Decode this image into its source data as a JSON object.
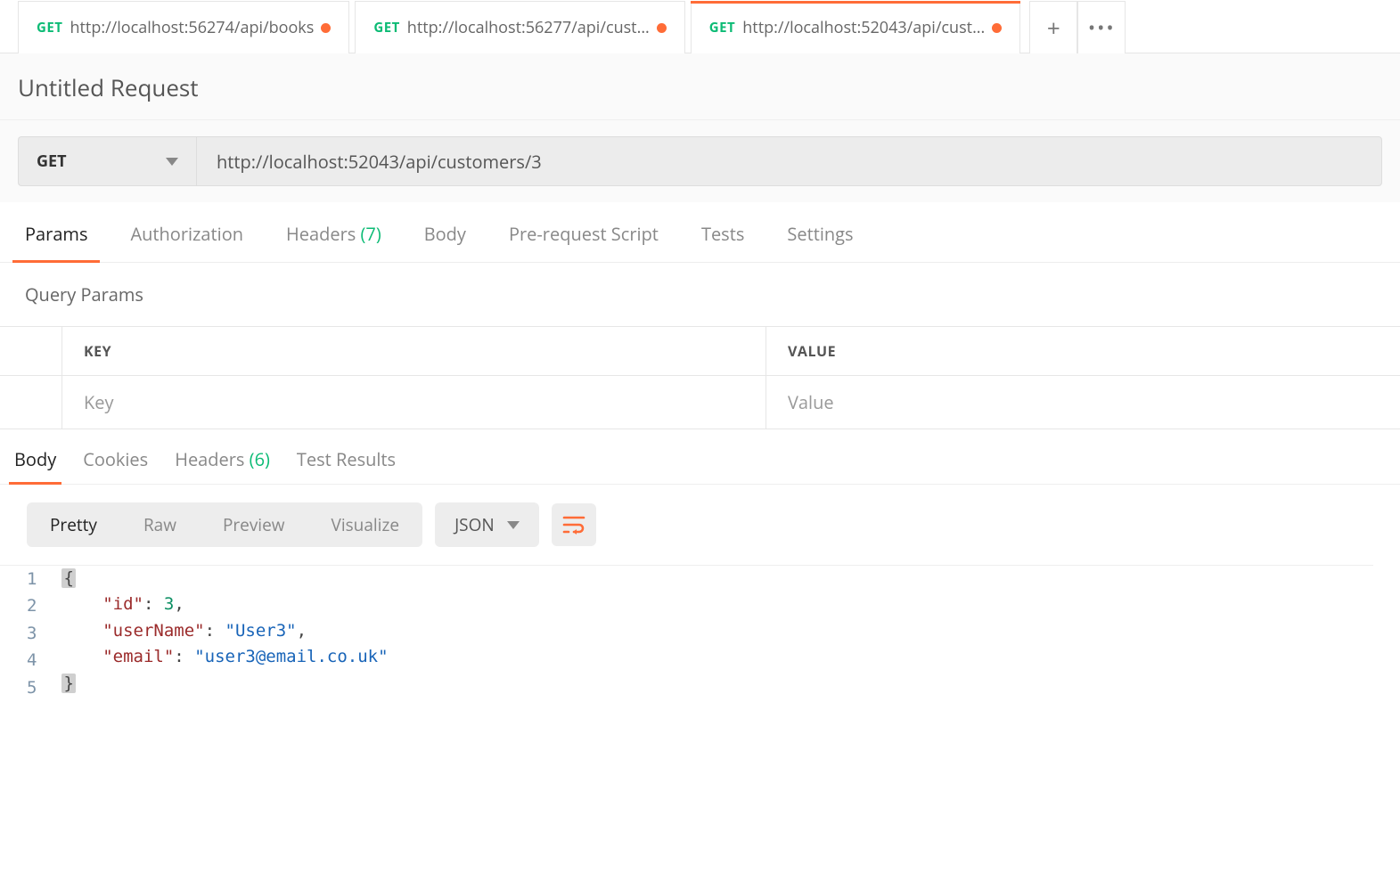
{
  "tabs": [
    {
      "method": "GET",
      "url": "http://localhost:56274/api/books",
      "dirty": true,
      "active": false
    },
    {
      "method": "GET",
      "url": "http://localhost:56277/api/cust...",
      "dirty": true,
      "active": false
    },
    {
      "method": "GET",
      "url": "http://localhost:52043/api/cust...",
      "dirty": true,
      "active": true
    }
  ],
  "request": {
    "title": "Untitled Request",
    "method": "GET",
    "url": "http://localhost:52043/api/customers/3"
  },
  "innerTabs": {
    "params": "Params",
    "authorization": "Authorization",
    "headers_label": "Headers",
    "headers_count": "(7)",
    "body": "Body",
    "prereq": "Pre-request Script",
    "tests": "Tests",
    "settings": "Settings"
  },
  "queryParams": {
    "section_title": "Query Params",
    "key_header": "KEY",
    "value_header": "VALUE",
    "key_placeholder": "Key",
    "value_placeholder": "Value"
  },
  "responseTabs": {
    "body": "Body",
    "cookies": "Cookies",
    "headers_label": "Headers",
    "headers_count": "(6)",
    "test_results": "Test Results"
  },
  "bodyViewer": {
    "pretty": "Pretty",
    "raw": "Raw",
    "preview": "Preview",
    "visualize": "Visualize",
    "format": "JSON"
  },
  "responseJson": {
    "id": 3,
    "userName": "User3",
    "email": "user3@email.co.uk"
  }
}
